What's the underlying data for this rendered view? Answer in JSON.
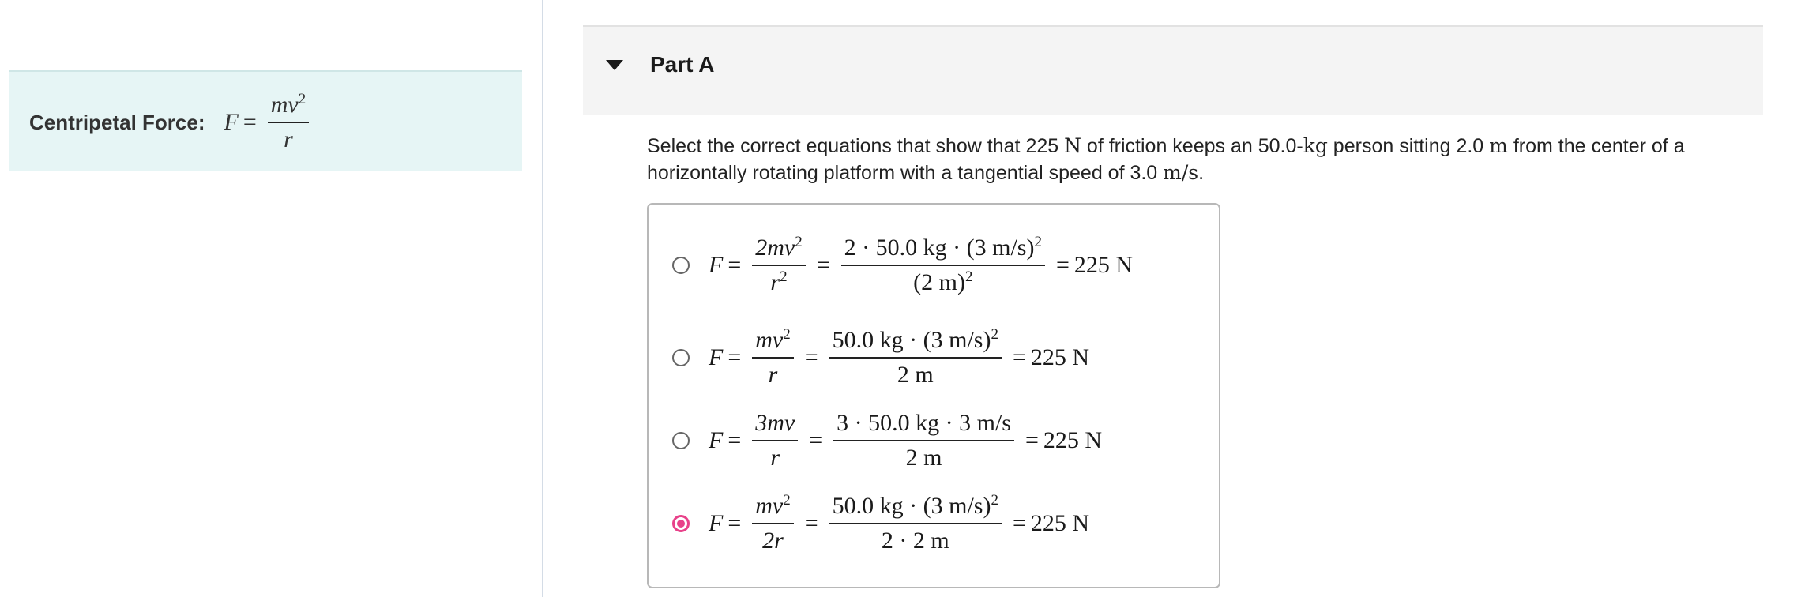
{
  "hint": {
    "label": "Centripetal Force:",
    "lhs": "F",
    "equals": "=",
    "num_base": "mv",
    "num_exp": "2",
    "den": "r"
  },
  "part": {
    "title": "Part A"
  },
  "question": {
    "t1": "Select the correct equations that show that 225 ",
    "u1": "N",
    "t2": " of friction keeps an 50.0-",
    "u2": "kg",
    "t3": " person sitting 2.0 ",
    "u3": "m",
    "t4": " from the center of a horizontally rotating platform with a tangential speed of 3.0 ",
    "u4": "m/s",
    "t5": "."
  },
  "options": [
    {
      "selected": false,
      "lhs": "F",
      "f1_num": "2mv",
      "f1_num_exp": "2",
      "f1_den": "r",
      "f1_den_exp": "2",
      "f2_num": "2 · 50.0 kg · (3 m/s)",
      "f2_num_exp": "2",
      "f2_den": "(2 m)",
      "f2_den_exp": "2",
      "result": "225 N"
    },
    {
      "selected": false,
      "lhs": "F",
      "f1_num": "mv",
      "f1_num_exp": "2",
      "f1_den": "r",
      "f1_den_exp": "",
      "f2_num": "50.0 kg · (3 m/s)",
      "f2_num_exp": "2",
      "f2_den": "2 m",
      "f2_den_exp": "",
      "result": "225 N"
    },
    {
      "selected": false,
      "lhs": "F",
      "f1_num": "3mv",
      "f1_num_exp": "",
      "f1_den": "r",
      "f1_den_exp": "",
      "f2_num": "3 · 50.0 kg · 3 m/s",
      "f2_num_exp": "",
      "f2_den": "2 m",
      "f2_den_exp": "",
      "result": "225 N"
    },
    {
      "selected": true,
      "lhs": "F",
      "f1_num": "mv",
      "f1_num_exp": "2",
      "f1_den": "2r",
      "f1_den_exp": "",
      "f2_num": "50.0 kg · (3 m/s)",
      "f2_num_exp": "2",
      "f2_den": "2 · 2 m",
      "f2_den_exp": "",
      "result": "225 N"
    }
  ],
  "colors": {
    "accent": "#e8428a",
    "hint_bg": "#e6f5f5",
    "header_bg": "#f4f4f4"
  }
}
